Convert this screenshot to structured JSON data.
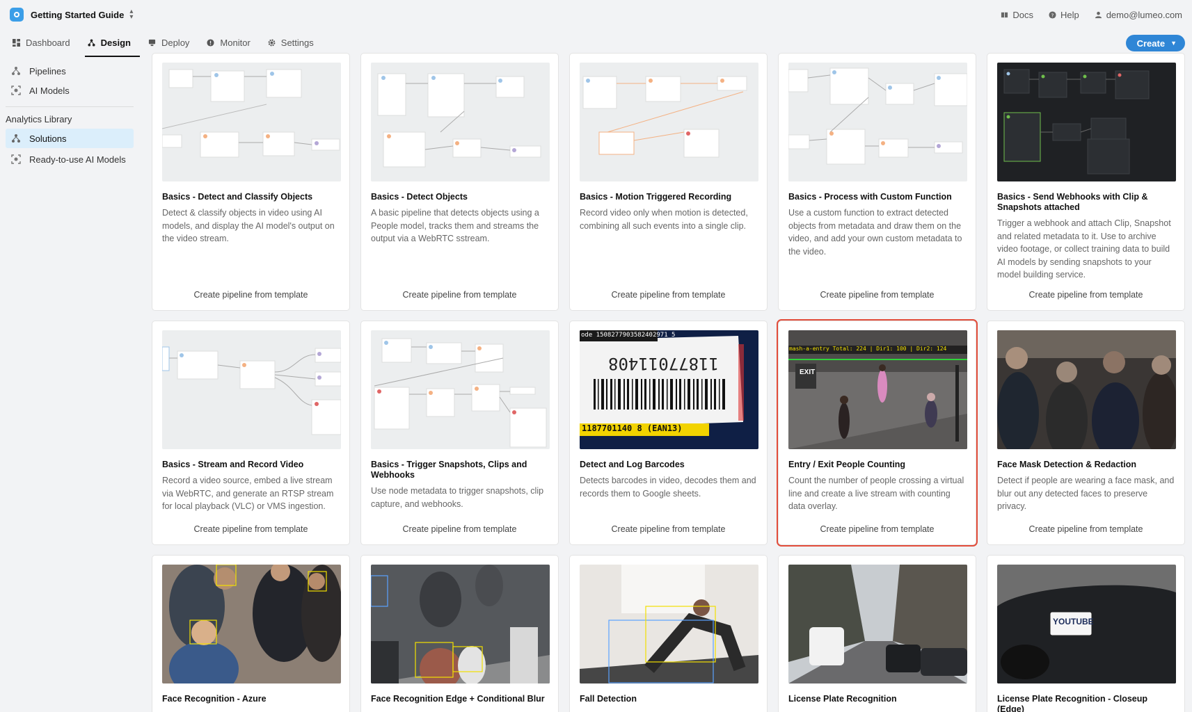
{
  "header": {
    "project_title": "Getting Started Guide",
    "docs": "Docs",
    "help": "Help",
    "user_email": "demo@lumeo.com"
  },
  "nav": {
    "tabs": [
      {
        "label": "Dashboard",
        "icon": "dashboard-icon"
      },
      {
        "label": "Design",
        "icon": "design-icon",
        "active": true
      },
      {
        "label": "Deploy",
        "icon": "deploy-icon"
      },
      {
        "label": "Monitor",
        "icon": "monitor-icon"
      },
      {
        "label": "Settings",
        "icon": "gear-icon"
      }
    ],
    "create_label": "Create"
  },
  "sidebar": {
    "items": [
      {
        "label": "Pipelines",
        "icon": "pipeline-icon"
      },
      {
        "label": "AI Models",
        "icon": "ai-model-icon"
      }
    ],
    "section_title": "Analytics Library",
    "library_items": [
      {
        "label": "Solutions",
        "icon": "pipeline-icon",
        "active": true
      },
      {
        "label": "Ready-to-use AI Models",
        "icon": "ai-model-icon"
      }
    ]
  },
  "cards": [
    {
      "title": "Basics - Detect and Classify Objects",
      "desc": "Detect & classify objects in video using AI models, and display the AI model's output on the video stream.",
      "action": "Create pipeline from template",
      "thumb": "graph-light"
    },
    {
      "title": "Basics - Detect Objects",
      "desc": "A basic pipeline that detects objects using a People model, tracks them and streams the output via a WebRTC sstream.",
      "action": "Create pipeline from template",
      "thumb": "graph-light"
    },
    {
      "title": "Basics - Motion Triggered Recording",
      "desc": "Record video only when motion is detected, combining all such events into a single clip.",
      "action": "Create pipeline from template",
      "thumb": "graph-light"
    },
    {
      "title": "Basics - Process with Custom Function",
      "desc": "Use a custom function to extract detected objects from metadata and draw them on the video, and add your own custom metadata to the video.",
      "action": "Create pipeline from template",
      "thumb": "graph-light"
    },
    {
      "title": "Basics - Send Webhooks with Clip & Snapshots attached",
      "desc": "Trigger a webhook and attach Clip, Snapshot and related metadata to it. Use to archive video footage, or collect training data to build AI models by sending snapshots to your model building service.",
      "action": "Create pipeline from template",
      "thumb": "graph-dark"
    },
    {
      "title": "Basics - Stream and Record Video",
      "desc": "Record a video source, embed a live stream via WebRTC, and generate an RTSP stream for local playback (VLC) or VMS ingestion.",
      "action": "Create pipeline from template",
      "thumb": "graph-light"
    },
    {
      "title": "Basics - Trigger Snapshots, Clips and Webhooks",
      "desc": "Use node metadata to trigger snapshots, clip capture, and webhooks.",
      "action": "Create pipeline from template",
      "thumb": "graph-light"
    },
    {
      "title": "Detect and Log Barcodes",
      "desc": "Detects barcodes in video, decodes them and records them to Google sheets.",
      "action": "Create pipeline from template",
      "thumb": "barcode",
      "overlay": {
        "top_text": "ode 1508277903582402971 5",
        "bottom_text": "1187701140 8 (EAN13)"
      }
    },
    {
      "title": "Entry / Exit People Counting",
      "desc": "Count the number of people crossing a virtual line and create a live stream with counting data overlay.",
      "action": "Create pipeline from template",
      "thumb": "people-count",
      "selected": true,
      "overlay": {
        "top_text": "mash-a-entry Total: 224 | Dir1: 100 | Dir2: 124",
        "sign_text": "EXIT"
      }
    },
    {
      "title": "Face Mask Detection & Redaction",
      "desc": "Detect if people are wearing a face mask, and blur out any detected faces to preserve privacy.",
      "action": "Create pipeline from template",
      "thumb": "crowd"
    },
    {
      "title": "Face Recognition - Azure",
      "desc": "",
      "action": "",
      "thumb": "photo-warm"
    },
    {
      "title": "Face Recognition Edge + Conditional Blur",
      "desc": "",
      "action": "",
      "thumb": "photo-gray"
    },
    {
      "title": "Fall Detection",
      "desc": "",
      "action": "",
      "thumb": "photo-light"
    },
    {
      "title": "License Plate Recognition",
      "desc": "",
      "action": "",
      "thumb": "street"
    },
    {
      "title": "License Plate Recognition - Closeup (Edge)",
      "desc": "",
      "action": "",
      "thumb": "car",
      "overlay": {
        "plate_text": "YOUTUBE"
      }
    }
  ]
}
